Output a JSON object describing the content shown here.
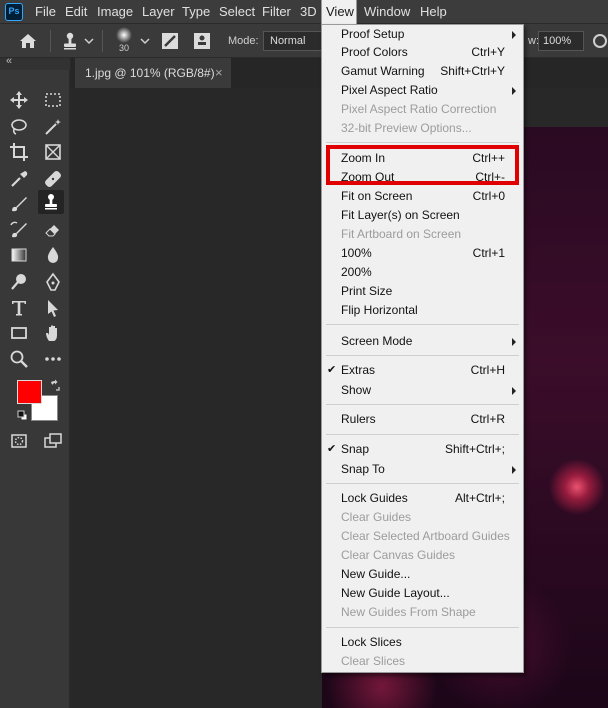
{
  "menubar": {
    "logo": "Ps",
    "items": [
      "File",
      "Edit",
      "Image",
      "Layer",
      "Type",
      "Select",
      "Filter",
      "3D",
      "View",
      "Window",
      "Help"
    ],
    "active": "View"
  },
  "options": {
    "brush_size": "30",
    "mode_label": "Mode:",
    "mode_value": "Normal",
    "flow_label": "w:",
    "flow_value": "100%"
  },
  "toolbar": {
    "collapse": "«"
  },
  "document": {
    "tab_title": "1.jpg @ 101% (RGB/8#)",
    "close": "×"
  },
  "view_menu": {
    "items": [
      {
        "label": "Proof Setup",
        "shortcut": "",
        "submenu": true
      },
      {
        "label": "Proof Colors",
        "shortcut": "Ctrl+Y"
      },
      {
        "label": "Gamut Warning",
        "shortcut": "Shift+Ctrl+Y"
      },
      {
        "label": "Pixel Aspect Ratio",
        "shortcut": "",
        "submenu": true
      },
      {
        "label": "Pixel Aspect Ratio Correction",
        "shortcut": "",
        "disabled": true
      },
      {
        "label": "32-bit Preview Options...",
        "shortcut": "",
        "disabled": true
      },
      {
        "label": "Zoom In",
        "shortcut": "Ctrl++"
      },
      {
        "label": "Zoom Out",
        "shortcut": "Ctrl+-"
      },
      {
        "label": "Fit on Screen",
        "shortcut": "Ctrl+0"
      },
      {
        "label": "Fit Layer(s) on Screen",
        "shortcut": ""
      },
      {
        "label": "Fit Artboard on Screen",
        "shortcut": "",
        "disabled": true
      },
      {
        "label": "100%",
        "shortcut": "Ctrl+1"
      },
      {
        "label": "200%",
        "shortcut": ""
      },
      {
        "label": "Print Size",
        "shortcut": ""
      },
      {
        "label": "Flip Horizontal",
        "shortcut": ""
      },
      {
        "label": "Screen Mode",
        "shortcut": "",
        "submenu": true
      },
      {
        "label": "Extras",
        "shortcut": "Ctrl+H",
        "checked": true
      },
      {
        "label": "Show",
        "shortcut": "",
        "submenu": true
      },
      {
        "label": "Rulers",
        "shortcut": "Ctrl+R"
      },
      {
        "label": "Snap",
        "shortcut": "Shift+Ctrl+;",
        "checked": true
      },
      {
        "label": "Snap To",
        "shortcut": "",
        "submenu": true
      },
      {
        "label": "Lock Guides",
        "shortcut": "Alt+Ctrl+;"
      },
      {
        "label": "Clear Guides",
        "shortcut": "",
        "disabled": true
      },
      {
        "label": "Clear Selected Artboard Guides",
        "shortcut": "",
        "disabled": true
      },
      {
        "label": "Clear Canvas Guides",
        "shortcut": "",
        "disabled": true
      },
      {
        "label": "New Guide...",
        "shortcut": ""
      },
      {
        "label": "New Guide Layout...",
        "shortcut": ""
      },
      {
        "label": "New Guides From Shape",
        "shortcut": "",
        "disabled": true
      },
      {
        "label": "Lock Slices",
        "shortcut": ""
      },
      {
        "label": "Clear Slices",
        "shortcut": "",
        "disabled": true
      }
    ],
    "checkmark": "✔"
  },
  "colors": {
    "foreground": "#ff0000",
    "background": "#ffffff",
    "highlight": "#e00000"
  }
}
